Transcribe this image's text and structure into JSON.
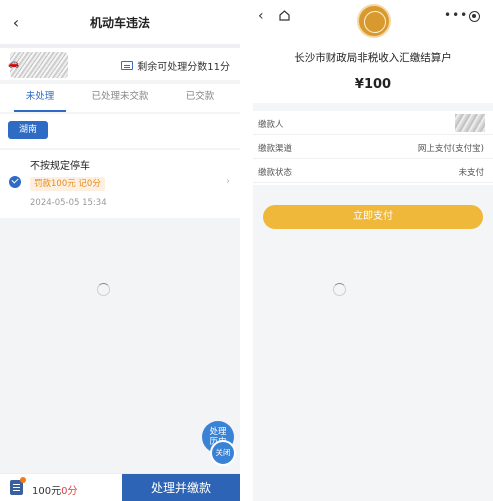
{
  "left": {
    "header": {
      "back_icon": "chevron-left-icon",
      "title": "机动车违法"
    },
    "vehicle": {
      "points_label": "剩余可处理分数11分",
      "card_icon": "id-card-icon"
    },
    "tabs": [
      {
        "label": "未处理",
        "active": true
      },
      {
        "label": "已处理未交款",
        "active": false
      },
      {
        "label": "已交款",
        "active": false
      }
    ],
    "filter": {
      "region_label": "湖南"
    },
    "violation": {
      "title": "不按规定停车",
      "badge": "罚款100元 记0分",
      "time": "2024-05-05 15:34",
      "checked": true
    },
    "fab": {
      "history_label_1": "处理",
      "history_label_2": "历史",
      "close_label": "关闭"
    },
    "bottom": {
      "amount_prefix": "100元",
      "amount_points": "0分",
      "pay_label": "处理并缴款"
    },
    "colors": {
      "primary": "#2d6bc4",
      "badge_text": "#e48a1e",
      "badge_bg": "#fdf0e0"
    }
  },
  "right": {
    "nav": {
      "back_icon": "chevron-left-icon",
      "home_icon": "home-icon",
      "more_icon": "more-dots-icon",
      "target_icon": "target-icon"
    },
    "logo": "seal-emblem",
    "title": "长沙市财政局非税收入汇缴结算户",
    "amount": "¥100",
    "info": [
      {
        "label": "缴款人",
        "value": ""
      },
      {
        "label": "缴款渠道",
        "value": "网上支付(支付宝)"
      },
      {
        "label": "缴款状态",
        "value": "未支付"
      }
    ],
    "pay_button": "立即支付",
    "colors": {
      "pay_button": "#f0b83a"
    }
  }
}
